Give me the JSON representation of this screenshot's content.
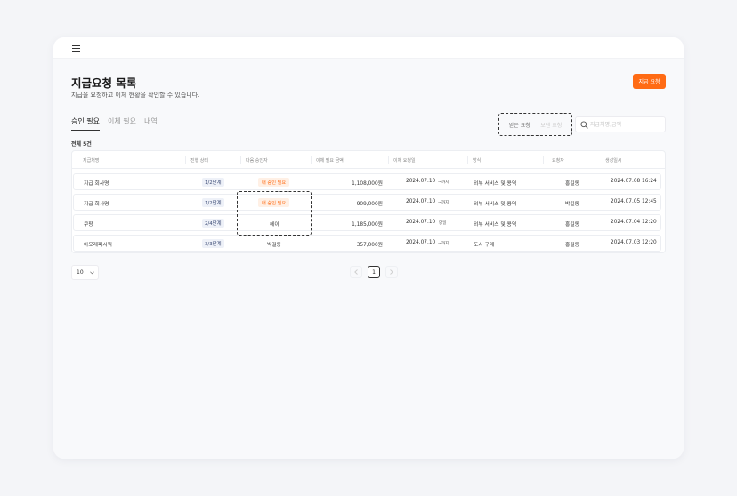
{
  "page": {
    "title": "지급요청 목록",
    "subtitle": "지급을 요청하고 이체 현황을 확인할 수 있습니다.",
    "request_button": "지급 요청"
  },
  "tabs": [
    {
      "label": "승인 필요",
      "active": true
    },
    {
      "label": "이체 필요",
      "active": false
    },
    {
      "label": "내역",
      "active": false
    }
  ],
  "filter": {
    "options": [
      {
        "label": "받은 요청",
        "active": true
      },
      {
        "label": "보낸 요청",
        "active": false
      }
    ]
  },
  "search": {
    "placeholder": "지급처명,금액",
    "value": ""
  },
  "total_label": "전체 5건",
  "table": {
    "headers": [
      "지급처명",
      "진행 상태",
      "다음 승인자",
      "이체 필요 금액",
      "이체 요청일",
      "방식",
      "요청자",
      "생성일시"
    ],
    "rows": [
      {
        "payee": "지급 회사명",
        "step": "1/2단계",
        "approver": "내 승인 필요",
        "approver_is_me": true,
        "amount": "1,108,000원",
        "date": "2024.07.10",
        "due": "~까지",
        "method": "외부 서비스 및 용역",
        "requester": "홍길동",
        "created": "2024.07.08 16:24"
      },
      {
        "payee": "지급 회사명",
        "step": "1/2단계",
        "approver": "내 승인 필요",
        "approver_is_me": true,
        "amount": "909,000원",
        "date": "2024.07.10",
        "due": "~까지",
        "method": "외부 서비스 및 용역",
        "requester": "박길동",
        "created": "2024.07.05 12:45"
      },
      {
        "payee": "쿠팡",
        "step": "2/4단계",
        "approver": "헤이",
        "approver_is_me": false,
        "amount": "1,185,000원",
        "date": "2024.07.10",
        "due": "당일",
        "method": "외부 서비스 및 용역",
        "requester": "홍길동",
        "created": "2024.07.04 12:20"
      },
      {
        "payee": "아모레퍼시픽",
        "step": "3/3단계",
        "approver": "박길동",
        "approver_is_me": false,
        "amount": "357,000원",
        "date": "2024.07.10",
        "due": "~까지",
        "method": "도서 구매",
        "requester": "홍길동",
        "created": "2024.07.03 12:20"
      }
    ]
  },
  "pagination": {
    "page_size": "10",
    "current_page": "1"
  },
  "colors": {
    "accent": "#ff6b14",
    "accent_soft": "#fff0e5",
    "badge_bg": "#eef1f8",
    "badge_text": "#3a4a75"
  },
  "icons": {
    "menu": "hamburger-icon",
    "search": "search-icon",
    "dropdown": "chevron-down-icon",
    "prev": "chevron-left-icon",
    "next": "chevron-right-icon"
  }
}
